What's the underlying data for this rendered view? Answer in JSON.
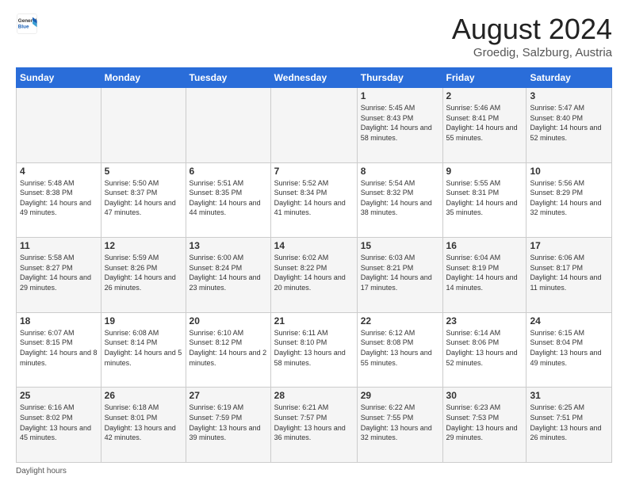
{
  "header": {
    "logo": {
      "general": "General",
      "blue": "Blue"
    },
    "title": "August 2024",
    "subtitle": "Groedig, Salzburg, Austria"
  },
  "days_of_week": [
    "Sunday",
    "Monday",
    "Tuesday",
    "Wednesday",
    "Thursday",
    "Friday",
    "Saturday"
  ],
  "weeks": [
    [
      {
        "num": "",
        "info": ""
      },
      {
        "num": "",
        "info": ""
      },
      {
        "num": "",
        "info": ""
      },
      {
        "num": "",
        "info": ""
      },
      {
        "num": "1",
        "info": "Sunrise: 5:45 AM\nSunset: 8:43 PM\nDaylight: 14 hours and 58 minutes."
      },
      {
        "num": "2",
        "info": "Sunrise: 5:46 AM\nSunset: 8:41 PM\nDaylight: 14 hours and 55 minutes."
      },
      {
        "num": "3",
        "info": "Sunrise: 5:47 AM\nSunset: 8:40 PM\nDaylight: 14 hours and 52 minutes."
      }
    ],
    [
      {
        "num": "4",
        "info": "Sunrise: 5:48 AM\nSunset: 8:38 PM\nDaylight: 14 hours and 49 minutes."
      },
      {
        "num": "5",
        "info": "Sunrise: 5:50 AM\nSunset: 8:37 PM\nDaylight: 14 hours and 47 minutes."
      },
      {
        "num": "6",
        "info": "Sunrise: 5:51 AM\nSunset: 8:35 PM\nDaylight: 14 hours and 44 minutes."
      },
      {
        "num": "7",
        "info": "Sunrise: 5:52 AM\nSunset: 8:34 PM\nDaylight: 14 hours and 41 minutes."
      },
      {
        "num": "8",
        "info": "Sunrise: 5:54 AM\nSunset: 8:32 PM\nDaylight: 14 hours and 38 minutes."
      },
      {
        "num": "9",
        "info": "Sunrise: 5:55 AM\nSunset: 8:31 PM\nDaylight: 14 hours and 35 minutes."
      },
      {
        "num": "10",
        "info": "Sunrise: 5:56 AM\nSunset: 8:29 PM\nDaylight: 14 hours and 32 minutes."
      }
    ],
    [
      {
        "num": "11",
        "info": "Sunrise: 5:58 AM\nSunset: 8:27 PM\nDaylight: 14 hours and 29 minutes."
      },
      {
        "num": "12",
        "info": "Sunrise: 5:59 AM\nSunset: 8:26 PM\nDaylight: 14 hours and 26 minutes."
      },
      {
        "num": "13",
        "info": "Sunrise: 6:00 AM\nSunset: 8:24 PM\nDaylight: 14 hours and 23 minutes."
      },
      {
        "num": "14",
        "info": "Sunrise: 6:02 AM\nSunset: 8:22 PM\nDaylight: 14 hours and 20 minutes."
      },
      {
        "num": "15",
        "info": "Sunrise: 6:03 AM\nSunset: 8:21 PM\nDaylight: 14 hours and 17 minutes."
      },
      {
        "num": "16",
        "info": "Sunrise: 6:04 AM\nSunset: 8:19 PM\nDaylight: 14 hours and 14 minutes."
      },
      {
        "num": "17",
        "info": "Sunrise: 6:06 AM\nSunset: 8:17 PM\nDaylight: 14 hours and 11 minutes."
      }
    ],
    [
      {
        "num": "18",
        "info": "Sunrise: 6:07 AM\nSunset: 8:15 PM\nDaylight: 14 hours and 8 minutes."
      },
      {
        "num": "19",
        "info": "Sunrise: 6:08 AM\nSunset: 8:14 PM\nDaylight: 14 hours and 5 minutes."
      },
      {
        "num": "20",
        "info": "Sunrise: 6:10 AM\nSunset: 8:12 PM\nDaylight: 14 hours and 2 minutes."
      },
      {
        "num": "21",
        "info": "Sunrise: 6:11 AM\nSunset: 8:10 PM\nDaylight: 13 hours and 58 minutes."
      },
      {
        "num": "22",
        "info": "Sunrise: 6:12 AM\nSunset: 8:08 PM\nDaylight: 13 hours and 55 minutes."
      },
      {
        "num": "23",
        "info": "Sunrise: 6:14 AM\nSunset: 8:06 PM\nDaylight: 13 hours and 52 minutes."
      },
      {
        "num": "24",
        "info": "Sunrise: 6:15 AM\nSunset: 8:04 PM\nDaylight: 13 hours and 49 minutes."
      }
    ],
    [
      {
        "num": "25",
        "info": "Sunrise: 6:16 AM\nSunset: 8:02 PM\nDaylight: 13 hours and 45 minutes."
      },
      {
        "num": "26",
        "info": "Sunrise: 6:18 AM\nSunset: 8:01 PM\nDaylight: 13 hours and 42 minutes."
      },
      {
        "num": "27",
        "info": "Sunrise: 6:19 AM\nSunset: 7:59 PM\nDaylight: 13 hours and 39 minutes."
      },
      {
        "num": "28",
        "info": "Sunrise: 6:21 AM\nSunset: 7:57 PM\nDaylight: 13 hours and 36 minutes."
      },
      {
        "num": "29",
        "info": "Sunrise: 6:22 AM\nSunset: 7:55 PM\nDaylight: 13 hours and 32 minutes."
      },
      {
        "num": "30",
        "info": "Sunrise: 6:23 AM\nSunset: 7:53 PM\nDaylight: 13 hours and 29 minutes."
      },
      {
        "num": "31",
        "info": "Sunrise: 6:25 AM\nSunset: 7:51 PM\nDaylight: 13 hours and 26 minutes."
      }
    ]
  ],
  "footer": {
    "note": "Daylight hours"
  }
}
